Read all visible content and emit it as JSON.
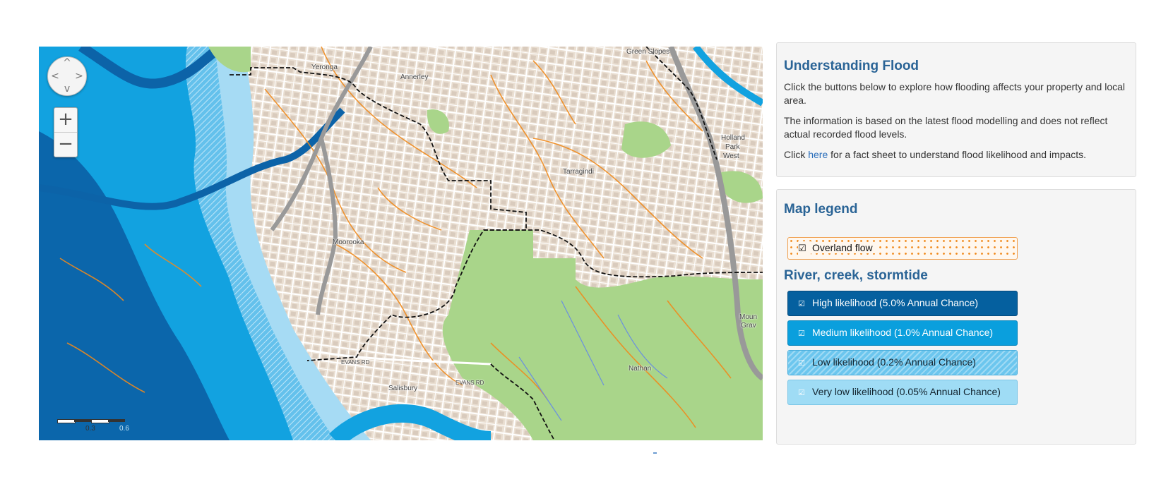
{
  "map": {
    "pan_arrows": {
      "up": "^",
      "down": "v",
      "left": "<",
      "right": ">"
    },
    "zoom_in_label": "+",
    "zoom_out_label": "−",
    "scale": {
      "label_1": "0.3",
      "label_2": "0.6"
    },
    "places": {
      "yeronga": "Yeronga",
      "annerley": "Annerley",
      "green_slopes": "Green Slopes",
      "moorooka": "Moorooka",
      "tarragindi": "Tarragindi",
      "holland_park_west_1": "Holland",
      "holland_park_west_2": "Park",
      "holland_park_west_3": "West",
      "salisbury": "Salisbury",
      "nathan": "Nathan",
      "mount_gravatt_1": "Moun",
      "mount_gravatt_2": "Grav",
      "evans_rd_1": "EVANS RD",
      "evans_rd_2": "EVANS RD"
    },
    "colors": {
      "land": "#eadfd2",
      "park": "#a9d58a",
      "flood_high": "#0c63a8",
      "flood_medium": "#12a2e0",
      "flood_low": "#64c1ec",
      "flood_very_low": "#a6dbf4",
      "overland": "#f08a1c",
      "boundary": "#111111"
    }
  },
  "understanding": {
    "title": "Understanding Flood",
    "para1": "Click the buttons below to explore how flooding affects your property and local area.",
    "para2": "The information is based on the latest flood modelling and does not reflect actual recorded flood levels.",
    "para3_prefix": "Click ",
    "para3_link": "here",
    "para3_suffix": " for a fact sheet to understand flood likelihood and impacts."
  },
  "legend": {
    "title": "Map legend",
    "overland_label": "Overland flow",
    "section_title": "River, creek, stormtide",
    "high_label": "High likelihood (5.0% Annual Chance)",
    "medium_label": "Medium likelihood (1.0% Annual Chance)",
    "low_label": "Low likelihood (0.2% Annual Chance)",
    "very_low_label": "Very low likelihood (0.05% Annual Chance)",
    "check_glyph": "☑"
  }
}
